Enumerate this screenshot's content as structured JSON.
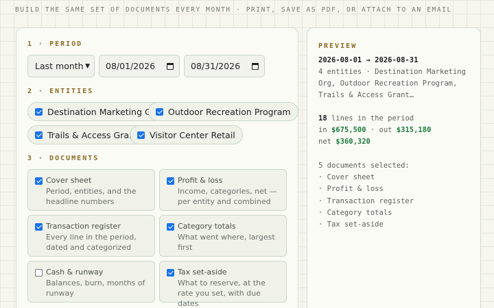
{
  "header": {
    "subtitle": "BUILD THE SAME SET OF DOCUMENTS EVERY MONTH · PRINT, SAVE AS PDF, OR ATTACH TO AN EMAIL"
  },
  "period": {
    "section_title": "1 · PERIOD",
    "preset_value": "Last month",
    "date_from": "08/01/2026",
    "date_to": "08/31/2026"
  },
  "entities": {
    "section_title": "2 · ENTITIES",
    "items": [
      {
        "label": "Destination Marketing Org",
        "checked": true
      },
      {
        "label": "Outdoor Recreation Program",
        "checked": true
      },
      {
        "label": "Trails & Access Grant",
        "checked": true
      },
      {
        "label": "Visitor Center Retail",
        "checked": true
      }
    ]
  },
  "documents": {
    "section_title": "3 · DOCUMENTS",
    "items": [
      {
        "title": "Cover sheet",
        "desc": "Period, entities, and the headline numbers",
        "checked": true
      },
      {
        "title": "Profit & loss",
        "desc": "Income, categories, net — per entity and combined",
        "checked": true
      },
      {
        "title": "Transaction register",
        "desc": "Every line in the period, dated and categorized",
        "checked": true
      },
      {
        "title": "Category totals",
        "desc": "What went where, largest first",
        "checked": true
      },
      {
        "title": "Cash & runway",
        "desc": "Balances, burn, months of runway",
        "checked": false
      },
      {
        "title": "Tax set-aside",
        "desc": "What to reserve, at the rate you set, with due dates",
        "checked": true
      }
    ]
  },
  "preview": {
    "title": "PREVIEW",
    "range": "2026-08-01 → 2026-08-31",
    "entities_summary": "4 entities · Destination Marketing Org, Outdoor Recreation Program, Trails & Access Grant…",
    "line_count": "18",
    "lines_text": " lines in the period",
    "in_label": "in ",
    "in_value": "$675,500",
    "out_label": " · out ",
    "out_value": "$315,180",
    "net_label": "net ",
    "net_value": "$360,320",
    "docs_selected": "5 documents selected:",
    "doc_list": [
      "· Cover sheet",
      "· Profit & loss",
      "· Transaction register",
      "· Category totals",
      "· Tax set-aside"
    ]
  },
  "colors": {
    "accent_gold": "#8a6a22",
    "money_green": "#1e7a3f",
    "checkbox_blue": "#1a73e8"
  }
}
